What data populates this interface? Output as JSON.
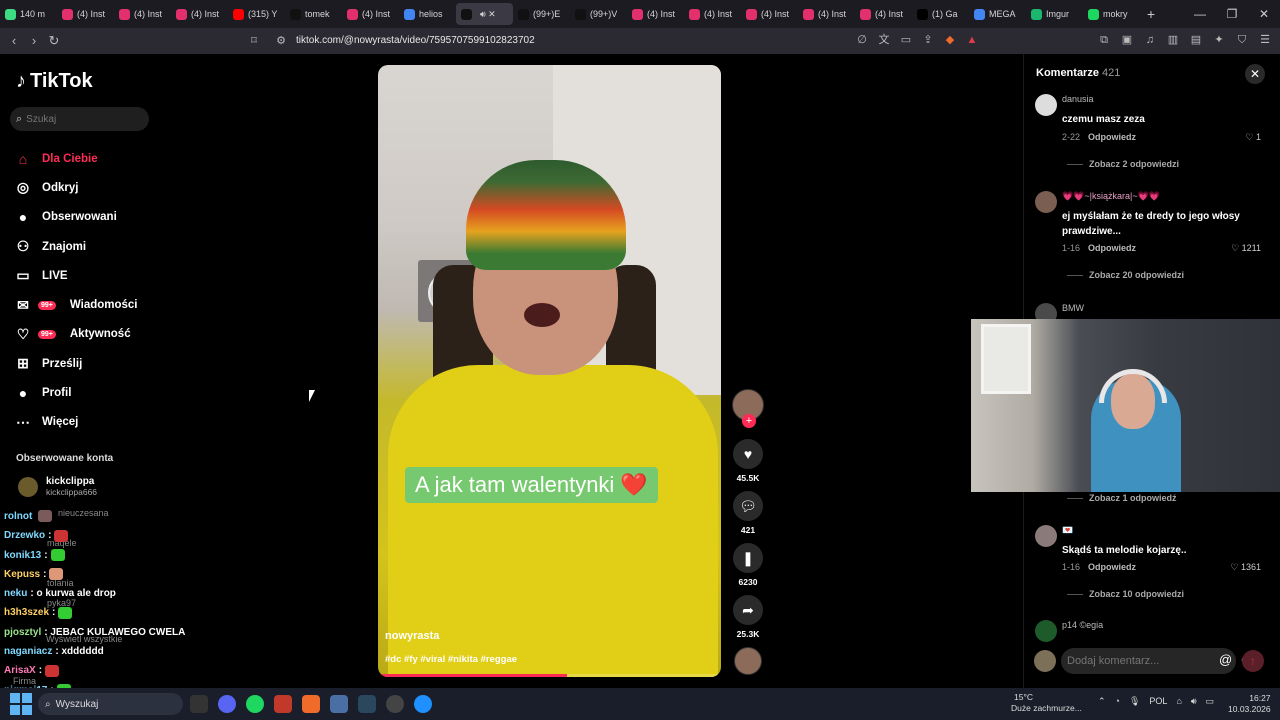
{
  "browser": {
    "tabs": [
      {
        "label": "140 m",
        "color": "#3ddc84"
      },
      {
        "label": "(4) Inst",
        "color": "#e1306c"
      },
      {
        "label": "(4) Inst",
        "color": "#e1306c"
      },
      {
        "label": "(4) Inst",
        "color": "#e1306c"
      },
      {
        "label": "(315) Y",
        "color": "#ff0000"
      },
      {
        "label": "tomek",
        "color": "#111111"
      },
      {
        "label": "(4) Inst",
        "color": "#e1306c"
      },
      {
        "label": "helios",
        "color": "#4285f4"
      },
      {
        "label": "",
        "color": "#111111"
      },
      {
        "label": "(99+)E",
        "color": "#111111"
      },
      {
        "label": "(99+)V",
        "color": "#111111"
      },
      {
        "label": "(4) Inst",
        "color": "#e1306c"
      },
      {
        "label": "(4) Inst",
        "color": "#e1306c"
      },
      {
        "label": "(4) Inst",
        "color": "#e1306c"
      },
      {
        "label": "(4) Inst",
        "color": "#e1306c"
      },
      {
        "label": "(4) Inst",
        "color": "#e1306c"
      },
      {
        "label": "(1) Ga",
        "color": "#000000"
      },
      {
        "label": "MEGA",
        "color": "#4285f4"
      },
      {
        "label": "Imgur",
        "color": "#1bb76e"
      },
      {
        "label": "mokry",
        "color": "#1ed760"
      }
    ],
    "url": "tiktok.com/@nowyrasta/video/7595707599102823702"
  },
  "sidebar": {
    "logo": "TikTok",
    "search_placeholder": "Szukaj",
    "items": [
      {
        "label": "Dla Ciebie",
        "icon": "home-icon",
        "glyph": "⌂"
      },
      {
        "label": "Odkryj",
        "icon": "compass-icon",
        "glyph": "◎"
      },
      {
        "label": "Obserwowani",
        "icon": "following-icon",
        "glyph": "●"
      },
      {
        "label": "Znajomi",
        "icon": "friends-icon",
        "glyph": "⚇"
      },
      {
        "label": "LIVE",
        "icon": "live-icon",
        "glyph": "▭"
      },
      {
        "label": "Wiadomości",
        "icon": "messages-icon",
        "glyph": "✉",
        "badge": "99+"
      },
      {
        "label": "Aktywność",
        "icon": "activity-icon",
        "glyph": "♡",
        "badge": "99+"
      },
      {
        "label": "Prześlij",
        "icon": "upload-icon",
        "glyph": "⊞"
      },
      {
        "label": "Profil",
        "icon": "profile-icon",
        "glyph": "●"
      },
      {
        "label": "Więcej",
        "icon": "more-icon",
        "glyph": "⋯"
      }
    ],
    "followed_title": "Obserwowane konta",
    "followed": [
      {
        "name": "kickclippa",
        "handle": "kickclippa666"
      }
    ],
    "ghost_names": [
      "nieuczesana",
      "maqele",
      "tolania",
      "pyka97",
      "Wyświetl wszystkie",
      "Firma"
    ]
  },
  "chat": [
    {
      "user": "rolnot",
      "text": "",
      "color": "#7fd9ff"
    },
    {
      "user": "Drzewko",
      "text": ":",
      "color": "#7fd9ff"
    },
    {
      "user": "konik13",
      "text": ":",
      "color": "#7fd9ff"
    },
    {
      "user": "Kepuss",
      "text": ":",
      "color": "#ffd166"
    },
    {
      "user": "neku",
      "text": ": o kurwa ale drop",
      "color": "#7fd9ff"
    },
    {
      "user": "h3h3szek",
      "text": ":",
      "color": "#ffd166"
    },
    {
      "user": "pjosztyl",
      "text": ": JEBAC KULAWEGO CWELA",
      "color": "#9be58b"
    },
    {
      "user": "naganiacz",
      "text": ": xdddddd",
      "color": "#7fd9ff"
    },
    {
      "user": "ArisaX",
      "text": ":",
      "color": "#ff7ab6"
    },
    {
      "user": "pigmej17",
      "text": ":",
      "color": "#7fd9ff"
    }
  ],
  "video": {
    "caption": "A jak tam walentynki ❤️",
    "username": "nowyrasta",
    "tags": "#dc #fy #viral #nikita #reggae",
    "progress": 0.55
  },
  "actions": {
    "likes": "45.5K",
    "comments": "421",
    "saves": "6230",
    "shares": "25.3K"
  },
  "comments": {
    "title": "Komentarze",
    "count": "421",
    "items": [
      {
        "user": "danusia",
        "text": "czemu masz zeza",
        "date": "2-22",
        "reply": "Odpowiedz",
        "likes": "1",
        "more": "Zobacz 2 odpowiedzi"
      },
      {
        "user": "💗💗~|książkara|~💗💗",
        "text": "ej myślałam że te dredy to jego włosy prawdziwe...",
        "date": "1-16",
        "reply": "Odpowiedz",
        "likes": "1211",
        "more": "Zobacz 20 odpowiedzi"
      },
      {
        "user": "BMW",
        "text": "",
        "date": "",
        "reply": "",
        "likes": "",
        "more": "Zobacz 1 odpowiedź"
      },
      {
        "user": "💌",
        "text": "Skądś ta melodie kojarzę..",
        "date": "1-16",
        "reply": "Odpowiedz",
        "likes": "1361",
        "more": "Zobacz 10 odpowiedzi"
      },
      {
        "user": "p14 ©egia",
        "text": "",
        "date": "",
        "reply": "",
        "likes": "",
        "more": ""
      }
    ],
    "input_placeholder": "Dodaj komentarz..."
  },
  "taskbar": {
    "search": "Wyszukaj",
    "weather_temp": "15°C",
    "weather_desc": "Duże zachmurze...",
    "lang": "POL",
    "time": "16:27",
    "date": "10.03.2026"
  }
}
